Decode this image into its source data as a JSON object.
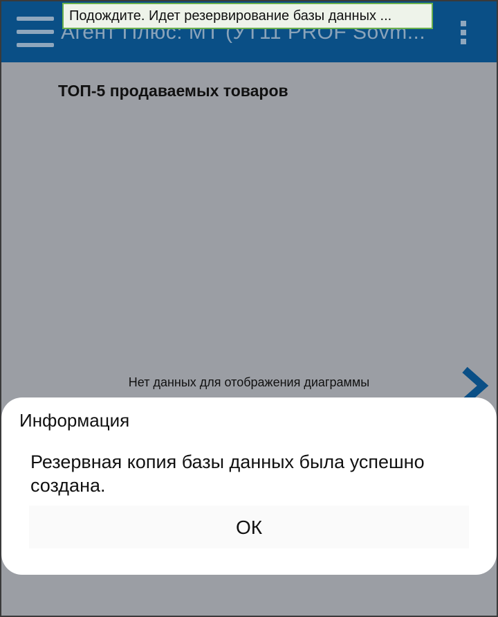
{
  "appbar": {
    "title": "Агент Плюс: МТ (УТ11 PROF Sovm...",
    "menu_icon": "hamburger-menu-icon",
    "overflow_icon": "more-vert-icon",
    "background_color": "#0a4f86"
  },
  "toast": {
    "text": "Подождите. Идет резервирование базы данных ..."
  },
  "main": {
    "section_title": "ТОП-5 продаваемых товаров",
    "no_data_text": "Нет данных для отображения диаграммы",
    "next_icon": "chevron-right-icon"
  },
  "dialog": {
    "title": "Информация",
    "message": "Резервная копия базы данных была успешно создана.",
    "ok_label": "ОК"
  }
}
